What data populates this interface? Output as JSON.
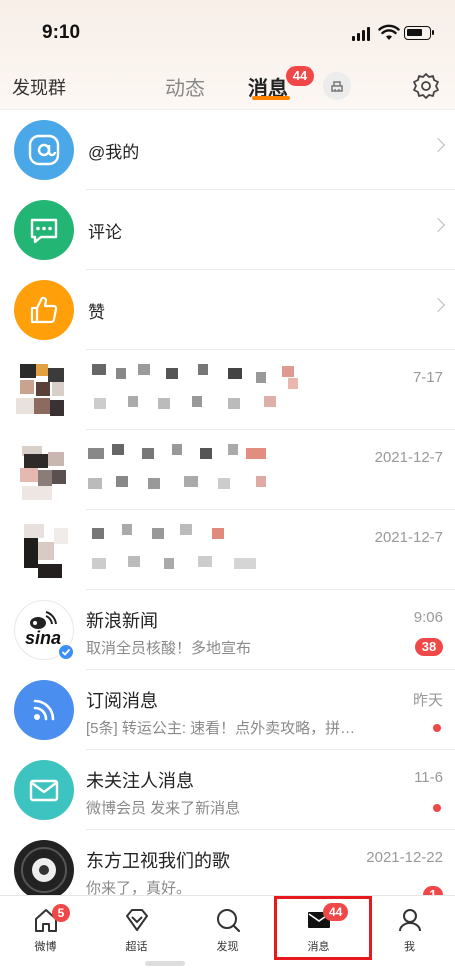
{
  "status_bar": {
    "time": "9:10"
  },
  "topnav": {
    "left_label": "发现群",
    "tab_dongtai": "动态",
    "tab_xiaoxi": "消息",
    "badge": "44"
  },
  "simple_items": [
    {
      "label": "@我的",
      "icon": "at-icon",
      "color": "#4aa8e8"
    },
    {
      "label": "评论",
      "icon": "comment-icon",
      "color": "#22b573"
    },
    {
      "label": "赞",
      "icon": "thumbs-up-icon",
      "color": "#ff9f0a"
    }
  ],
  "blurred_messages": [
    {
      "time": "7-17"
    },
    {
      "time": "2021-12-7"
    },
    {
      "time": "2021-12-7"
    }
  ],
  "messages": [
    {
      "title": "新浪新闻",
      "preview": "取消全员核酸！多地宣布",
      "time": "9:06",
      "badge": "38",
      "avatar_text": "sina"
    },
    {
      "title": "订阅消息",
      "preview": "[5条] 转运公主: 速看！点外卖攻略，拼…",
      "time": "昨天"
    },
    {
      "title": "未关注人消息",
      "preview": "微博会员 发来了新消息",
      "time": "11-6"
    },
    {
      "title": "东方卫视我们的歌",
      "preview": "你来了，真好。",
      "time": "2021-12-22",
      "badge": "1"
    }
  ],
  "tabbar": {
    "items": [
      {
        "label": "微博",
        "icon": "home-icon",
        "badge": "5"
      },
      {
        "label": "超话",
        "icon": "diamond-icon"
      },
      {
        "label": "发现",
        "icon": "search-icon"
      },
      {
        "label": "消息",
        "icon": "mail-icon",
        "badge": "44"
      },
      {
        "label": "我",
        "icon": "profile-icon"
      }
    ]
  },
  "colors": {
    "accent": "#ff8200",
    "badge": "#f04848",
    "highlight": "#e8191d"
  }
}
